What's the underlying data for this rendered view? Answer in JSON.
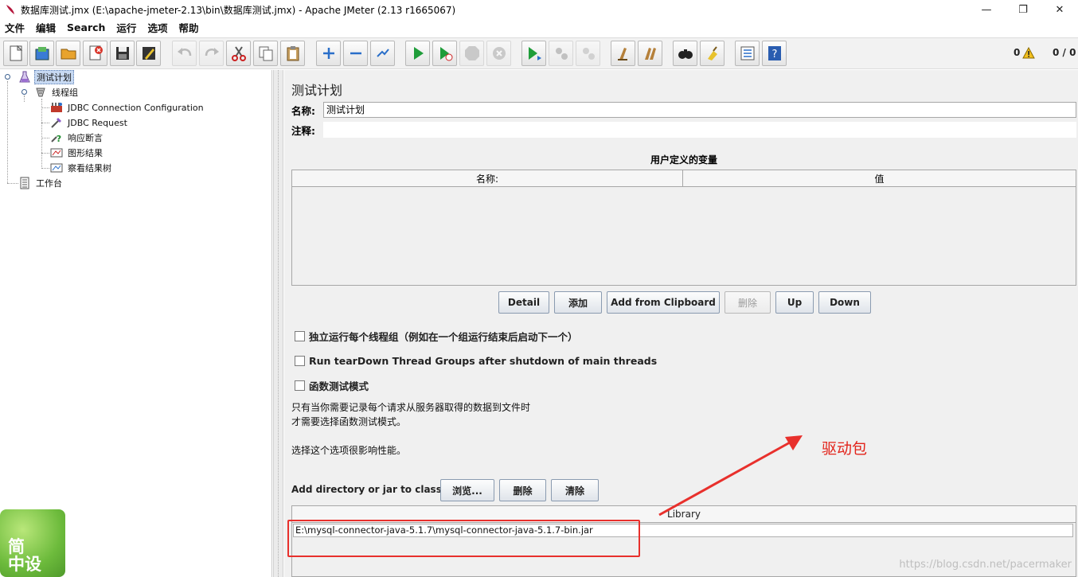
{
  "window": {
    "title": "数据库测试.jmx (E:\\apache-jmeter-2.13\\bin\\数据库测试.jmx) - Apache JMeter (2.13 r1665067)",
    "controls": [
      "—",
      "❐",
      "✕"
    ]
  },
  "menu": [
    "文件",
    "编辑",
    "Search",
    "运行",
    "选项",
    "帮助"
  ],
  "toolbar": {
    "error_count": "0",
    "ratio": "0 / 0",
    "buttons": [
      {
        "name": "new-icon"
      },
      {
        "name": "templates-icon"
      },
      {
        "name": "open-icon"
      },
      {
        "name": "close-icon"
      },
      {
        "name": "save-icon"
      },
      {
        "name": "save-as-icon"
      },
      {
        "name": "undo-icon",
        "disabled": true
      },
      {
        "name": "redo-icon",
        "disabled": true
      },
      {
        "name": "cut-icon"
      },
      {
        "name": "copy-icon"
      },
      {
        "name": "paste-icon"
      },
      {
        "name": "expand-icon"
      },
      {
        "name": "collapse-icon"
      },
      {
        "name": "toggle-icon"
      },
      {
        "name": "start-icon"
      },
      {
        "name": "start-no-pause-icon"
      },
      {
        "name": "stop-icon",
        "disabled": true
      },
      {
        "name": "shutdown-icon",
        "disabled": true
      },
      {
        "name": "remote-start-icon"
      },
      {
        "name": "remote-stop-icon",
        "disabled": true
      },
      {
        "name": "remote-exit-icon",
        "disabled": true
      },
      {
        "name": "clear-icon"
      },
      {
        "name": "clear-all-icon"
      },
      {
        "name": "search-icon"
      },
      {
        "name": "reset-search-icon"
      },
      {
        "name": "function-helper-icon"
      },
      {
        "name": "help-icon"
      }
    ]
  },
  "tree": {
    "nodes": [
      {
        "label": "测试计划",
        "icon": "test-plan-icon",
        "selected": true
      },
      {
        "label": "线程组",
        "icon": "thread-group-icon"
      },
      {
        "label": "JDBC Connection Configuration",
        "icon": "jdbc-config-icon"
      },
      {
        "label": "JDBC Request",
        "icon": "jdbc-request-icon"
      },
      {
        "label": "响应断言",
        "icon": "assertion-icon"
      },
      {
        "label": "图形结果",
        "icon": "graph-results-icon"
      },
      {
        "label": "察看结果树",
        "icon": "results-tree-icon"
      },
      {
        "label": "工作台",
        "icon": "workbench-icon"
      }
    ]
  },
  "panel": {
    "title": "测试计划",
    "name_label": "名称:",
    "name_value": "测试计划",
    "comment_label": "注释:",
    "comment_value": "",
    "vars_title": "用户定义的变量",
    "vars_columns": [
      "名称:",
      "值"
    ],
    "buttons": {
      "detail": "Detail",
      "add": "添加",
      "add_clipboard": "Add from Clipboard",
      "delete": "删除",
      "up": "Up",
      "down": "Down"
    },
    "checks": [
      {
        "label": "独立运行每个线程组（例如在一个组运行结束后启动下一个）",
        "checked": false
      },
      {
        "label": "Run tearDown Thread Groups after shutdown of main threads",
        "checked": false
      },
      {
        "label": "函数测试模式",
        "checked": false
      }
    ],
    "functional_note_1": "只有当你需要记录每个请求从服务器取得的数据到文件时",
    "functional_note_2": "才需要选择函数测试模式。",
    "performance_note": "选择这个选项很影响性能。",
    "classpath_label": "Add directory or jar to classpath",
    "classpath_buttons": {
      "browse": "浏览...",
      "delete": "删除",
      "clear": "清除"
    },
    "library_header": "Library",
    "library_rows": [
      "E:\\mysql-connector-java-5.1.7\\mysql-connector-java-5.1.7-bin.jar"
    ]
  },
  "annotation": {
    "label": "驱动包",
    "color": "#e2231a"
  },
  "watermark": {
    "logo_text": [
      "简",
      "中设"
    ],
    "site": "https://blog.csdn.net/pacermaker"
  }
}
